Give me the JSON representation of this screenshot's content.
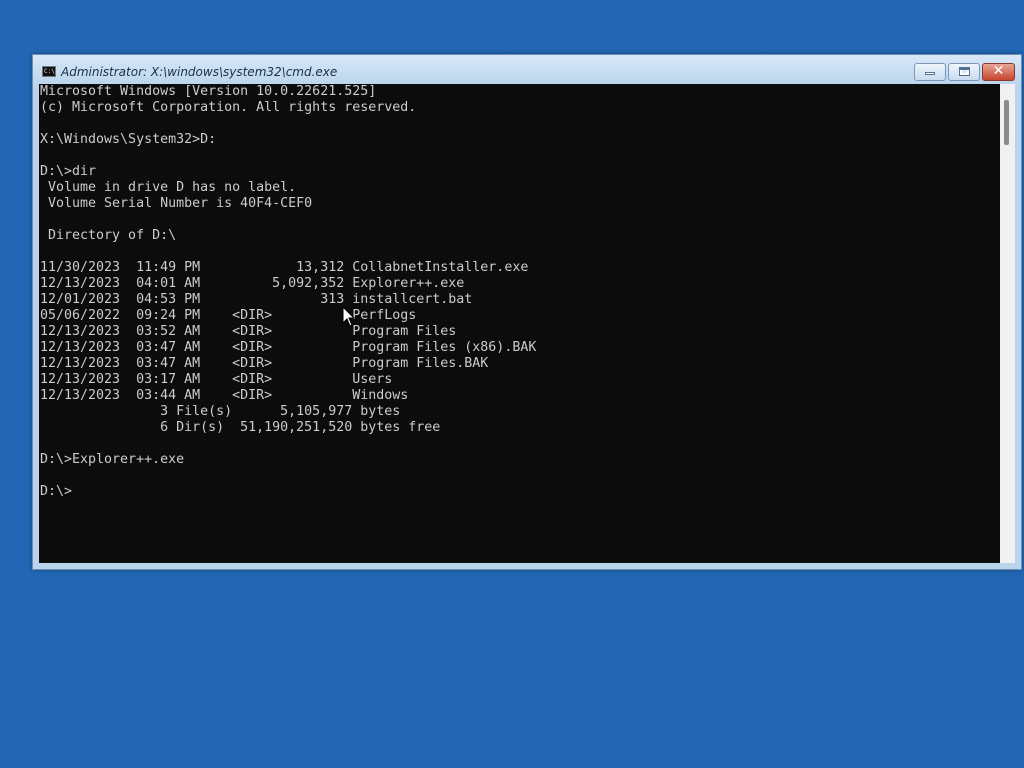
{
  "window": {
    "title": "Administrator: X:\\windows\\system32\\cmd.exe",
    "icon_text": "C:\\",
    "buttons": {
      "minimize": "minimize",
      "maximize": "maximize",
      "close": "✕"
    }
  },
  "console": {
    "lines": [
      "Microsoft Windows [Version 10.0.22621.525]",
      "(c) Microsoft Corporation. All rights reserved.",
      "",
      "X:\\Windows\\System32>D:",
      "",
      "D:\\>dir",
      " Volume in drive D has no label.",
      " Volume Serial Number is 40F4-CEF0",
      "",
      " Directory of D:\\",
      "",
      "11/30/2023  11:49 PM            13,312 CollabnetInstaller.exe",
      "12/13/2023  04:01 AM         5,092,352 Explorer++.exe",
      "12/01/2023  04:53 PM               313 installcert.bat",
      "05/06/2022  09:24 PM    <DIR>          PerfLogs",
      "12/13/2023  03:52 AM    <DIR>          Program Files",
      "12/13/2023  03:47 AM    <DIR>          Program Files (x86).BAK",
      "12/13/2023  03:47 AM    <DIR>          Program Files.BAK",
      "12/13/2023  03:17 AM    <DIR>          Users",
      "12/13/2023  03:44 AM    <DIR>          Windows",
      "               3 File(s)      5,105,977 bytes",
      "               6 Dir(s)  51,190,251,520 bytes free",
      "",
      "D:\\>Explorer++.exe",
      "",
      "D:\\>"
    ]
  },
  "colors": {
    "desktop": "#2266b4",
    "console_bg": "#0c0c0c",
    "console_fg": "#cccccc",
    "close_button": "#c7452e"
  }
}
